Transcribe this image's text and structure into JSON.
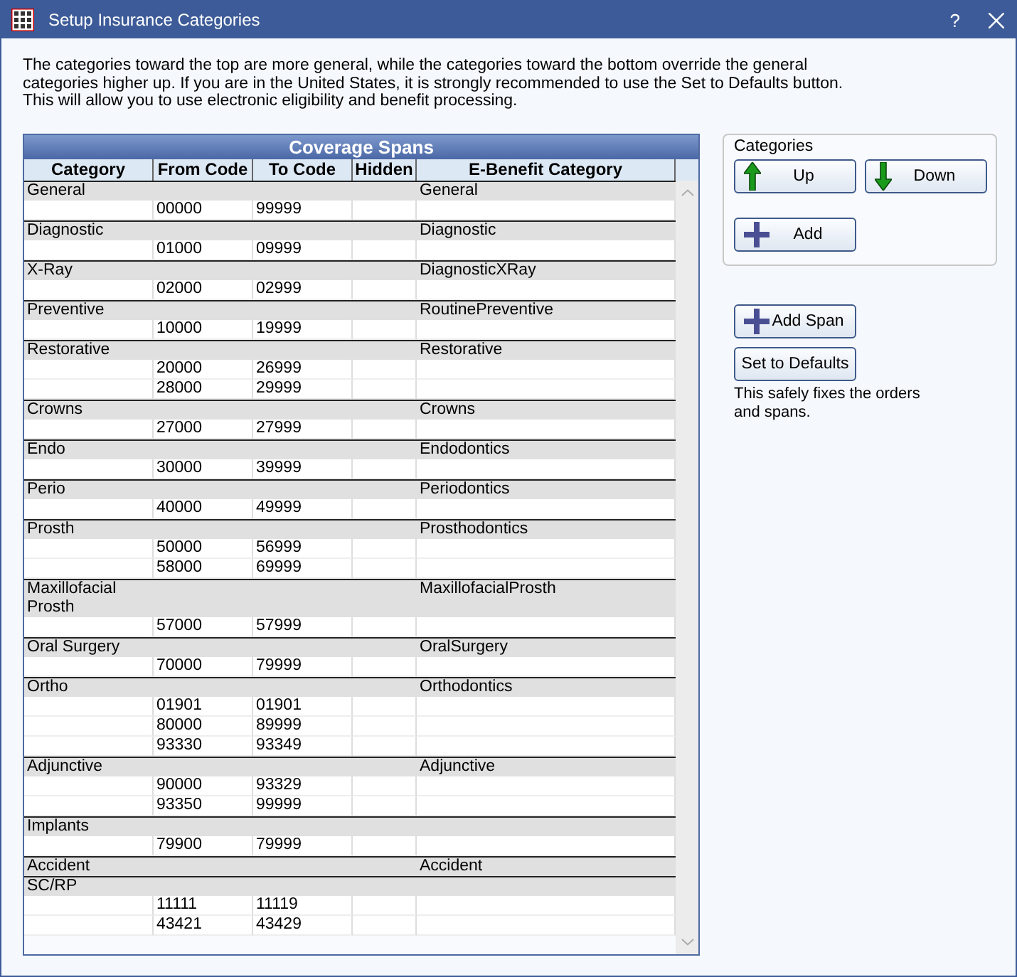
{
  "window": {
    "title": "Setup Insurance Categories",
    "help": "?"
  },
  "description": "The categories toward the top are more general, while the categories toward the bottom override the general categories higher up.  If you are in the United States, it is strongly recommended to use the Set to Defaults button. This will allow you to use electronic eligibility and benefit processing.",
  "grid": {
    "title": "Coverage Spans",
    "columns": [
      "Category",
      "From Code",
      "To Code",
      "Hidden",
      "E-Benefit Category"
    ],
    "categories": [
      {
        "name": "General",
        "ebenefit": "General",
        "spans": [
          {
            "from": "00000",
            "to": "99999"
          }
        ]
      },
      {
        "name": "Diagnostic",
        "ebenefit": "Diagnostic",
        "spans": [
          {
            "from": "01000",
            "to": "09999"
          }
        ]
      },
      {
        "name": "X-Ray",
        "ebenefit": "DiagnosticXRay",
        "spans": [
          {
            "from": "02000",
            "to": "02999"
          }
        ]
      },
      {
        "name": "Preventive",
        "ebenefit": "RoutinePreventive",
        "spans": [
          {
            "from": "10000",
            "to": "19999"
          }
        ]
      },
      {
        "name": "Restorative",
        "ebenefit": "Restorative",
        "spans": [
          {
            "from": "20000",
            "to": "26999"
          },
          {
            "from": "28000",
            "to": "29999"
          }
        ]
      },
      {
        "name": "Crowns",
        "ebenefit": "Crowns",
        "spans": [
          {
            "from": "27000",
            "to": "27999"
          }
        ]
      },
      {
        "name": "Endo",
        "ebenefit": "Endodontics",
        "spans": [
          {
            "from": "30000",
            "to": "39999"
          }
        ]
      },
      {
        "name": "Perio",
        "ebenefit": "Periodontics",
        "spans": [
          {
            "from": "40000",
            "to": "49999"
          }
        ]
      },
      {
        "name": "Prosth",
        "ebenefit": "Prosthodontics",
        "spans": [
          {
            "from": "50000",
            "to": "56999"
          },
          {
            "from": "58000",
            "to": "69999"
          }
        ]
      },
      {
        "name": "Maxillofacial Prosth",
        "ebenefit": "MaxillofacialProsth",
        "spans": [
          {
            "from": "57000",
            "to": "57999"
          }
        ]
      },
      {
        "name": "Oral Surgery",
        "ebenefit": "OralSurgery",
        "spans": [
          {
            "from": "70000",
            "to": "79999"
          }
        ]
      },
      {
        "name": "Ortho",
        "ebenefit": "Orthodontics",
        "spans": [
          {
            "from": "01901",
            "to": "01901"
          },
          {
            "from": "80000",
            "to": "89999"
          },
          {
            "from": "93330",
            "to": "93349"
          }
        ]
      },
      {
        "name": "Adjunctive",
        "ebenefit": "Adjunctive",
        "spans": [
          {
            "from": "90000",
            "to": "93329"
          },
          {
            "from": "93350",
            "to": "99999"
          }
        ]
      },
      {
        "name": "Implants",
        "spans": [
          {
            "from": "79900",
            "to": "79999"
          }
        ]
      },
      {
        "name": "Accident",
        "ebenefit": "Accident"
      },
      {
        "name": "SC/RP",
        "spans": [
          {
            "from": "11111",
            "to": "11119"
          },
          {
            "from": "43421",
            "to": "43429"
          }
        ]
      }
    ]
  },
  "categories_group": {
    "label": "Categories",
    "buttons": [
      {
        "label": "Up",
        "kind": "up"
      },
      {
        "label": "Down",
        "kind": "down"
      },
      {
        "label": "Add",
        "kind": "add"
      }
    ]
  },
  "span_buttons": [
    {
      "label": "Add Span",
      "kind": "add"
    },
    {
      "label": "Set to Defaults",
      "kind": "plain"
    }
  ],
  "defaults_note": "This safely fixes the orders and spans."
}
